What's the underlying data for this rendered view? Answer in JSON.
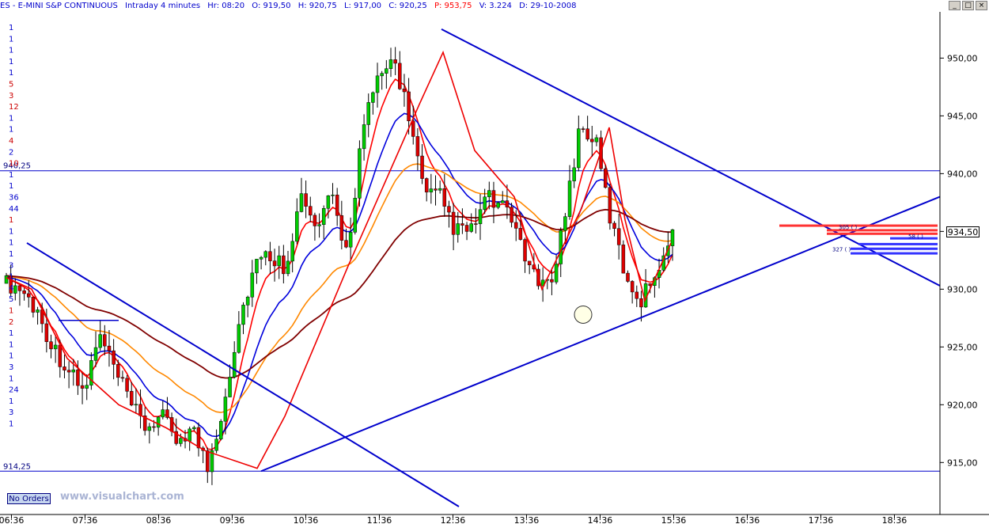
{
  "header": {
    "symbol": "ES - E-MINI S&P CONTINUOUS",
    "interval": "Intraday 4 minutes",
    "hour": "Hr: 08:20",
    "open": "O: 919,50",
    "high": "H: 920,75",
    "low": "L: 917,00",
    "close": "C: 920,25",
    "prev": "P: 953,75",
    "volume": "V: 3.224",
    "date": "D: 29-10-2008"
  },
  "window_buttons": [
    "_",
    "□",
    "×"
  ],
  "orders_button": "No Orders",
  "watermark": "www.visualchart.com",
  "current_price": "934,50",
  "colors": {
    "up_candle": "#00cc00",
    "down_candle": "#dd0000",
    "trendline": "#0000cc",
    "ma_fast": "#ff0000",
    "ma_mid": "#0000dd",
    "ma_orange": "#ff8800",
    "ma_slow": "#800000"
  },
  "chart_data": {
    "type": "candlestick",
    "ylim": [
      910.5,
      954
    ],
    "y_ticks": [
      "915,00",
      "920,00",
      "925,00",
      "930,00",
      "935,00",
      "940,00",
      "945,00",
      "950,00"
    ],
    "x_ticks": [
      "06:36",
      "07:36",
      "08:36",
      "09:36",
      "10:36",
      "11:36",
      "12:36",
      "13:36",
      "14:36",
      "15:36",
      "16:36",
      "17:36",
      "18:36"
    ],
    "level_lines": [
      {
        "label": "940,25",
        "value": 940.25
      },
      {
        "label": "914,25",
        "value": 914.25
      }
    ],
    "left_numbers": [
      "1",
      "1",
      "1",
      "1",
      "1",
      "5",
      "3",
      "12",
      "1",
      "1",
      "4",
      "2",
      "10",
      "1",
      "1",
      "36",
      "44",
      "1",
      "1",
      "1",
      "1",
      "3",
      "1",
      "4",
      "5",
      "1",
      "2",
      "1",
      "1",
      "1",
      "3",
      "1",
      "24",
      "1",
      "3",
      "1"
    ],
    "order_labels": [
      "305 ( )",
      "58 ( )",
      "327 ( )"
    ],
    "series": [
      {
        "name": "",
        "key": "close_path",
        "values": [
          930.5,
          930,
          928,
          925,
          923,
          921,
          926,
          923,
          920,
          918,
          919,
          917,
          918,
          914.5,
          920,
          927,
          932,
          933,
          932,
          938,
          935,
          938,
          933,
          944,
          948,
          950,
          945,
          938,
          938,
          935,
          935,
          938,
          937,
          935,
          931,
          930,
          936,
          944,
          943,
          936,
          931,
          929,
          932,
          934.5
        ]
      }
    ],
    "annotations": [
      {
        "type": "trendline",
        "points": [
          [
            "06:36",
            934
          ],
          [
            "09:36",
            919
          ]
        ]
      },
      {
        "type": "trendline",
        "points": [
          [
            "09:36",
            914.25
          ],
          [
            "19:00",
            938
          ]
        ]
      },
      {
        "type": "trendline",
        "points": [
          [
            "11:45",
            952.5
          ],
          [
            "19:00",
            930.5
          ]
        ]
      },
      {
        "type": "circle",
        "at": [
          "13:56",
          927.8
        ]
      }
    ]
  }
}
